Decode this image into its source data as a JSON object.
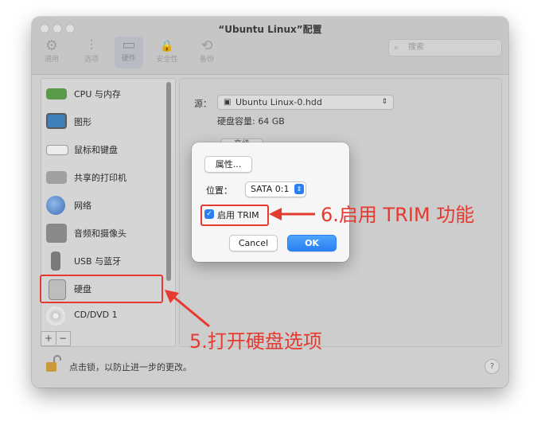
{
  "window": {
    "title": "“Ubuntu Linux”配置"
  },
  "toolbar": {
    "items": [
      {
        "label": "通用",
        "icon": "gear-icon",
        "glyph": "⚙"
      },
      {
        "label": "选项",
        "icon": "sliders-icon",
        "glyph": "⫶"
      },
      {
        "label": "硬件",
        "icon": "hardware-icon",
        "glyph": "▭"
      },
      {
        "label": "安全性",
        "icon": "lock-icon",
        "glyph": "🔒"
      },
      {
        "label": "备份",
        "icon": "backup-clock-icon",
        "glyph": "⟲"
      }
    ],
    "active_index": 2,
    "search": {
      "placeholder": "搜索",
      "icon": "search-icon",
      "glyph": "⌕"
    }
  },
  "sidebar": {
    "items": [
      {
        "label": "CPU 与内存",
        "icon": "cpu-memory-icon",
        "color": "#5a9a4a"
      },
      {
        "label": "图形",
        "icon": "monitor-icon",
        "color": "#3f7fb8"
      },
      {
        "label": "鼠标和键盘",
        "icon": "keyboard-icon",
        "color": "#e6e6e6"
      },
      {
        "label": "共享的打印机",
        "icon": "printer-icon",
        "color": "#9a9a9a"
      },
      {
        "label": "网络",
        "icon": "globe-icon",
        "color": "#4c7fc4"
      },
      {
        "label": "音频和摄像头",
        "icon": "audio-camera-icon",
        "color": "#8a8a8a"
      },
      {
        "label": "USB 与蓝牙",
        "icon": "usb-icon",
        "color": "#7a7a7a"
      },
      {
        "label": "硬盘",
        "icon": "hard-disk-icon",
        "color": "#b8b8b8"
      },
      {
        "label": "CD/DVD 1",
        "icon": "cd-dvd-icon",
        "color": "#d0d0d0"
      }
    ],
    "add_symbol": "+",
    "remove_symbol": "−"
  },
  "content": {
    "source_label": "源：",
    "source_value": "Ubuntu Linux-0.hdd",
    "source_icon": "disk-file-icon",
    "capacity_text": "硬盘容量: 64 GB",
    "advanced_label": "高级"
  },
  "dialog": {
    "properties_button": "属性...",
    "location_label": "位置：",
    "location_value": "SATA 0:1",
    "trim_checkbox_label": "启用 TRIM",
    "trim_checked": true,
    "cancel_label": "Cancel",
    "ok_label": "OK"
  },
  "footer": {
    "lock_text": "点击锁，以防止进一步的更改。",
    "help_symbol": "?"
  },
  "annotations": {
    "step5": "5.打开硬盘选项",
    "step6": "6.启用 TRIM 功能",
    "color": "#e53a2f"
  }
}
